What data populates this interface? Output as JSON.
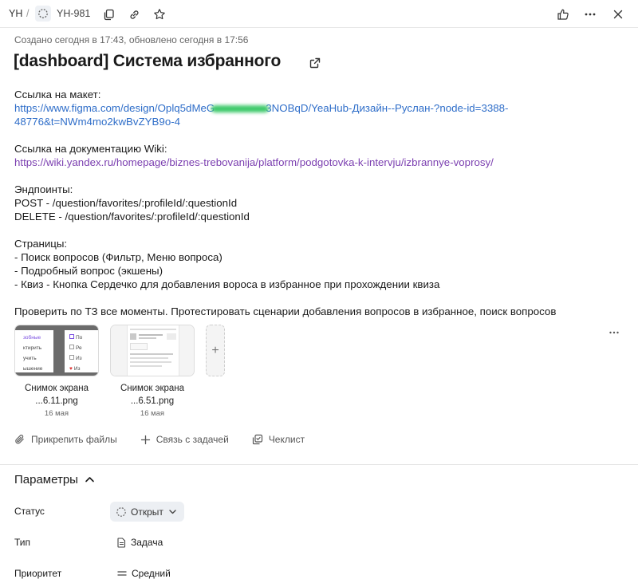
{
  "breadcrumb": {
    "queue": "YH",
    "separator": "/",
    "issue_key": "YH-981"
  },
  "meta": "Создано сегодня в 17:43, обновлено сегодня в 17:56",
  "title": "[dashboard] Система избранного",
  "description": {
    "mockup_label": "Ссылка на макет:",
    "mockup_link_start": "https://www.figma.com/design/Oplq5dMeG",
    "mockup_link_end": "3NOBqD/YeaHub-Дизайн--Руслан-?node-id=3388-",
    "mockup_link_line2": "48776&t=NWm4mo2kwBvZYB9o-4",
    "wiki_label": "Ссылка на документацию Wiki:",
    "wiki_link": "https://wiki.yandex.ru/homepage/biznes-trebovanija/platform/podgotovka-k-intervju/izbrannye-voprosy/",
    "endpoints_label": "Эндпоинты:",
    "endpoints": [
      "POST - /question/favorites/:profileId/:questionId",
      "DELETE - /question/favorites/:profileId/:questionId"
    ],
    "pages_label": "Страницы:",
    "pages": [
      "- Поиск вопросов (Фильтр, Меню вопроса)",
      "- Подробный вопрос (экшены)",
      "- Квиз - Кнопка Сердечко для добавления вороса в избранное при прохождении квиза"
    ],
    "check_note": "Проверить по ТЗ все моменты. Протестировать сценарии добавления вопросов в избранное, поиск вопросов"
  },
  "attachments": [
    {
      "name_line1": "Снимок экрана",
      "name_line2": "...6.11.png",
      "date": "16 мая",
      "preview_left": [
        "зобные",
        "ктирить",
        "учить",
        "ышение"
      ],
      "preview_right": [
        "По",
        "Ре",
        "Из",
        "Из"
      ]
    },
    {
      "name_line1": "Снимок экрана",
      "name_line2": "...6.51.png",
      "date": "16 мая"
    }
  ],
  "add_attachment": "+",
  "actions": {
    "attach_files": "Прикрепить файлы",
    "link_task": "Связь с задачей",
    "checklist": "Чеклист"
  },
  "params": {
    "header": "Параметры",
    "status_label": "Статус",
    "status_value": "Открыт",
    "type_label": "Тип",
    "type_value": "Задача",
    "priority_label": "Приоритет",
    "priority_value": "Средний"
  },
  "icons": {
    "status": "status-open-ring-icon",
    "copy": "copy-icon",
    "link": "link-icon",
    "favorite": "star-icon",
    "like": "thumbs-up-icon",
    "more": "more-horizontal-icon",
    "close": "close-icon",
    "external": "external-link-icon"
  },
  "colors": {
    "link": "#2f6ec9",
    "visited_link": "#7b3fb0",
    "chip_bg": "#eceff3"
  }
}
